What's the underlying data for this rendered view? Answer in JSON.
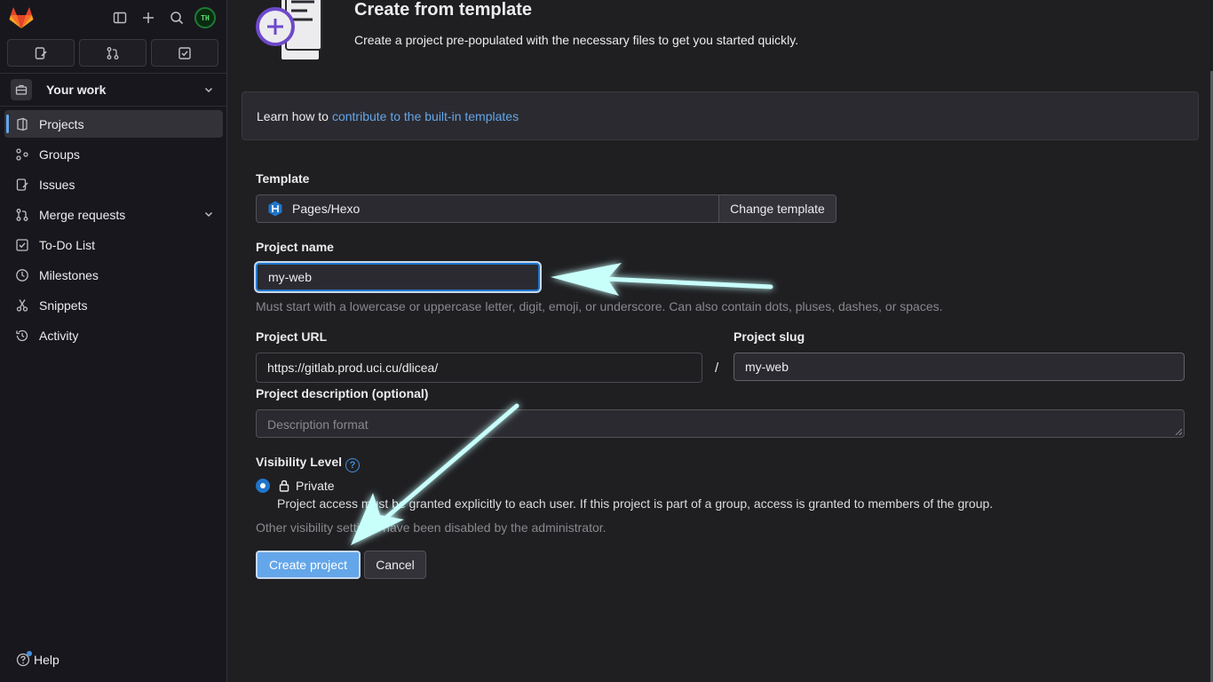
{
  "sidebar": {
    "avatar_initials": "TH",
    "context_label": "Your work",
    "items": [
      {
        "label": "Projects",
        "icon": "project-icon"
      },
      {
        "label": "Groups",
        "icon": "group-icon"
      },
      {
        "label": "Issues",
        "icon": "issues-icon"
      },
      {
        "label": "Merge requests",
        "icon": "merge-request-icon"
      },
      {
        "label": "To-Do List",
        "icon": "todo-icon"
      },
      {
        "label": "Milestones",
        "icon": "milestone-icon"
      },
      {
        "label": "Snippets",
        "icon": "snippet-icon"
      },
      {
        "label": "Activity",
        "icon": "history-icon"
      }
    ],
    "help_label": "Help"
  },
  "header": {
    "title": "Create from template",
    "subtitle": "Create a project pre-populated with the necessary files to get you started quickly."
  },
  "info": {
    "text": "Learn how to",
    "link": "contribute to the built-in templates"
  },
  "form": {
    "template_label": "Template",
    "template_value": "Pages/Hexo",
    "change_template": "Change template",
    "project_name_label": "Project name",
    "project_name_value": "my-web",
    "project_name_hint": "Must start with a lowercase or uppercase letter, digit, emoji, or underscore. Can also contain dots, pluses, dashes, or spaces.",
    "project_url_label": "Project URL",
    "project_url_value": "https://gitlab.prod.uci.cu/dlicea/",
    "slash": "/",
    "project_slug_label": "Project slug",
    "project_slug_value": "my-web",
    "description_label": "Project description (optional)",
    "description_placeholder": "Description format",
    "visibility_label": "Visibility Level",
    "visibility_help": "?",
    "visibility_option": "Private",
    "visibility_desc": "Project access must be granted explicitly to each user. If this project is part of a group, access is granted to members of the group.",
    "visibility_note": "Other visibility settings have been disabled by the administrator.",
    "create_button": "Create project",
    "cancel_button": "Cancel"
  },
  "colors": {
    "accent": "#63a6e9",
    "link": "#63a6e9",
    "annotation_arrow": "#c8fffb"
  }
}
